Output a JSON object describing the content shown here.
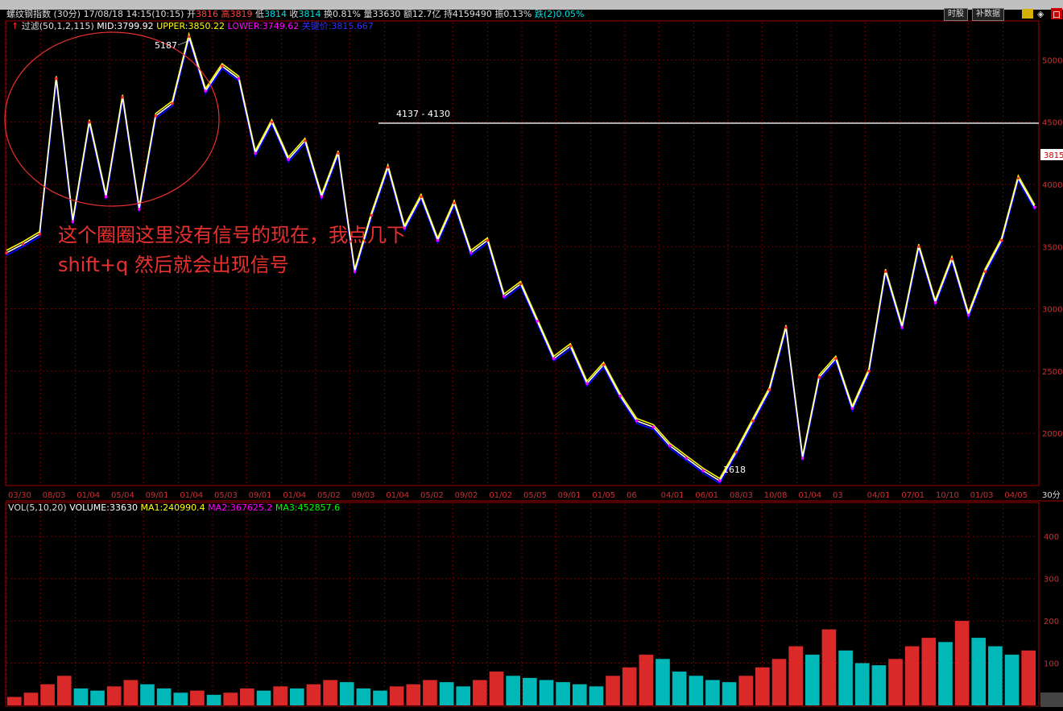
{
  "header": {
    "name": "螺纹钢指数",
    "period": "(30分)",
    "datetime": "17/08/18 14:15(10:15)",
    "open_label": "开",
    "open": "3816",
    "high_label": "高",
    "high": "3819",
    "low_label": "低",
    "low": "3814",
    "close_label": "收",
    "close": "3814",
    "turnover": "换0.81%",
    "volume": "量33630",
    "amount": "额12.7亿",
    "hold": "持4159490",
    "amplitude": "振0.13%",
    "change": "跌(2)0.05%"
  },
  "buttons": {
    "time_share": "时股",
    "supplement": "补数据"
  },
  "indicator_line": {
    "name": "过滤(50,1,2,115)",
    "mid": "MID:3799.92",
    "upper": "UPPER:3850.22",
    "lower": "LOWER:3749.62",
    "key": "关键价:3815.667"
  },
  "volume_line": {
    "name": "VOL(5,10,20)",
    "volume": "VOLUME:33630",
    "ma1": "MA1:240990.4",
    "ma2": "MA2:367625.2",
    "ma3": "MA3:452857.6"
  },
  "annotation": {
    "line1": "这个圈圈这里没有信号的现在，我点几下",
    "line2": "shift+q 然后就会出现信号"
  },
  "price_labels": {
    "high_peak": "5187",
    "range": "4137 - 4130",
    "low_trough": "1618",
    "current_tag": "3815"
  },
  "right_tab": "30分",
  "colors": {
    "up": "#ff3030",
    "down": "#00d8d8",
    "grid": "#8b0000",
    "price_line": "#ffffff",
    "mid": "#ffffff",
    "upper": "#ffff00",
    "lower": "#ff00ff",
    "key": "#0000ff"
  },
  "chart_data": [
    {
      "type": "line",
      "title": "螺纹钢指数 (30分)",
      "x_ticks": [
        "03/30",
        "08/03",
        "01/04",
        "05/04",
        "09/01",
        "01/04",
        "05/03",
        "09/01",
        "01/04",
        "05/02",
        "09/03",
        "01/04",
        "05/02",
        "09/02",
        "01/02",
        "05/05",
        "09/01",
        "01/05",
        "06",
        "04/01",
        "06/01",
        "08/03",
        "10/08",
        "01/04",
        "03",
        "04/01",
        "07/01",
        "10/10",
        "01/03",
        "04/05"
      ],
      "y_ticks": [
        2000,
        2500,
        3000,
        3500,
        4000,
        4500,
        5000
      ],
      "ylim": [
        1600,
        5300
      ],
      "series": [
        {
          "values": [
            3450,
            3520,
            3600,
            4850,
            3700,
            4500,
            3900,
            4700,
            3800,
            4550,
            4650,
            5187,
            4750,
            4950,
            4850,
            4250,
            4500,
            4200,
            4350,
            3900,
            4250,
            3300,
            3750,
            4137,
            3650,
            3900,
            3550,
            3850,
            3450,
            3550,
            3100,
            3200,
            2900,
            2600,
            2700,
            2400,
            2550,
            2300,
            2100,
            2050,
            1900,
            1800,
            1700,
            1618,
            1850,
            2100,
            2350,
            2850,
            1800,
            2450,
            2600,
            2200,
            2500,
            3300,
            2850,
            3500,
            3050,
            3400,
            2950,
            3300,
            3550,
            4050,
            3815
          ]
        }
      ]
    },
    {
      "type": "bar",
      "title": "VOL(5,10,20)",
      "y_ticks": [
        100,
        200,
        300,
        400
      ],
      "ylim": [
        0,
        450
      ],
      "values": [
        20,
        30,
        50,
        70,
        40,
        35,
        45,
        60,
        50,
        40,
        30,
        35,
        25,
        30,
        40,
        35,
        45,
        40,
        50,
        60,
        55,
        40,
        35,
        45,
        50,
        60,
        55,
        45,
        60,
        80,
        70,
        65,
        60,
        55,
        50,
        45,
        70,
        90,
        120,
        110,
        80,
        70,
        60,
        55,
        70,
        90,
        110,
        140,
        120,
        180,
        130,
        100,
        95,
        110,
        140,
        160,
        150,
        200,
        160,
        140,
        120,
        130
      ]
    }
  ]
}
